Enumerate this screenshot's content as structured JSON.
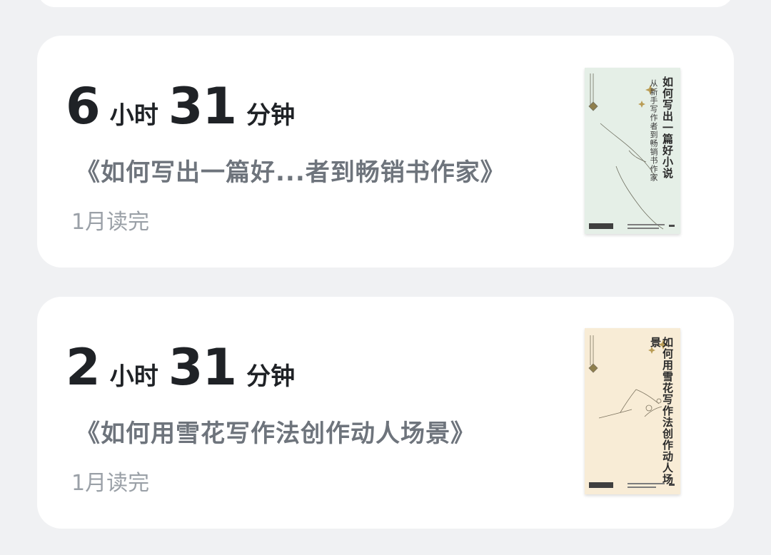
{
  "items": [
    {
      "hours": "6",
      "hours_unit": "小时",
      "minutes": "31",
      "minutes_unit": "分钟",
      "book_title": "《如何写出一篇好...者到畅销书作家》",
      "status": "1月读完",
      "cover": {
        "title": "如何写出一篇好小说",
        "subtitle": "从新手写作者到畅销书作家",
        "bg_color": "#e5efe7",
        "icon": "book-cover-writing"
      }
    },
    {
      "hours": "2",
      "hours_unit": "小时",
      "minutes": "31",
      "minutes_unit": "分钟",
      "book_title": "《如何用雪花写作法创作动人场景》",
      "status": "1月读完",
      "cover": {
        "title": "如何用雪花写作法创作动人场景",
        "bg_color": "#f8ecd6",
        "icon": "book-cover-snowflake"
      }
    }
  ],
  "colors": {
    "background": "#f0f1f3",
    "card": "#ffffff",
    "primary_text": "#1f2226",
    "title_text": "#6e747c",
    "secondary_text": "#9aa0a7"
  }
}
